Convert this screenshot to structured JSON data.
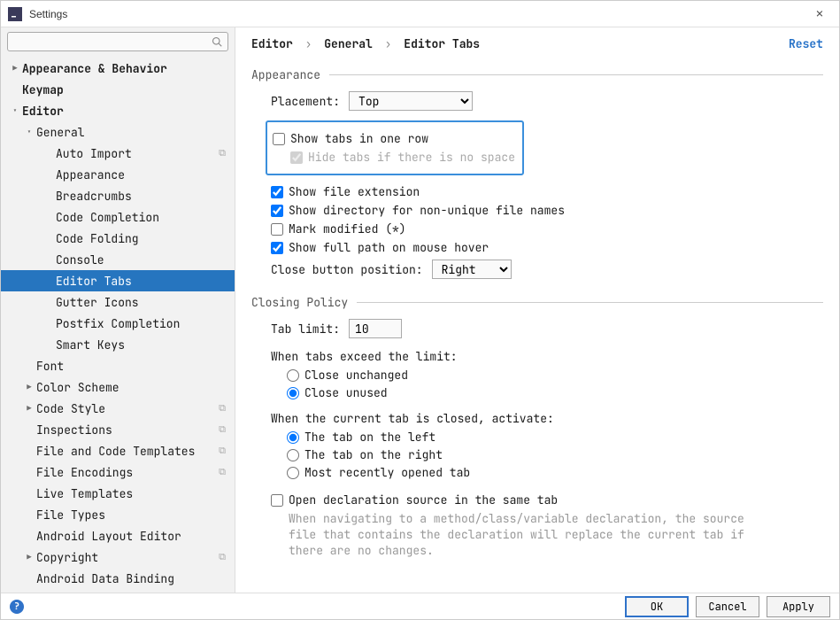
{
  "window": {
    "title": "Settings"
  },
  "search": {
    "placeholder": ""
  },
  "tree": {
    "appearance_behavior": "Appearance & Behavior",
    "keymap": "Keymap",
    "editor": "Editor",
    "general": "General",
    "auto_import": "Auto Import",
    "appearance": "Appearance",
    "breadcrumbs": "Breadcrumbs",
    "code_completion": "Code Completion",
    "code_folding": "Code Folding",
    "console": "Console",
    "editor_tabs": "Editor Tabs",
    "gutter_icons": "Gutter Icons",
    "postfix_completion": "Postfix Completion",
    "smart_keys": "Smart Keys",
    "font": "Font",
    "color_scheme": "Color Scheme",
    "code_style": "Code Style",
    "inspections": "Inspections",
    "file_code_templates": "File and Code Templates",
    "file_encodings": "File Encodings",
    "live_templates": "Live Templates",
    "file_types": "File Types",
    "android_layout_editor": "Android Layout Editor",
    "copyright": "Copyright",
    "android_data_binding": "Android Data Binding"
  },
  "breadcrumb": {
    "p0": "Editor",
    "p1": "General",
    "p2": "Editor Tabs"
  },
  "reset": "Reset",
  "sections": {
    "appearance": "Appearance",
    "closing_policy": "Closing Policy"
  },
  "appearance": {
    "placement_label": "Placement:",
    "placement_value": "Top",
    "show_tabs_one_row": "Show tabs in one row",
    "hide_tabs_no_space": "Hide tabs if there is no space",
    "show_file_ext": "Show file extension",
    "show_dir_nonunique": "Show directory for non-unique file names",
    "mark_modified": "Mark modified (*)",
    "show_full_path_hover": "Show full path on mouse hover",
    "close_button_position_label": "Close button position:",
    "close_button_position_value": "Right"
  },
  "closing": {
    "tab_limit_label": "Tab limit:",
    "tab_limit_value": "10",
    "exceed_label": "When tabs exceed the limit:",
    "exceed_close_unchanged": "Close unchanged",
    "exceed_close_unused": "Close unused",
    "current_closed_label": "When the current tab is closed, activate:",
    "activate_left": "The tab on the left",
    "activate_right": "The tab on the right",
    "activate_recent": "Most recently opened tab",
    "open_decl_same_tab": "Open declaration source in the same tab",
    "open_decl_desc": "When navigating to a method/class/variable declaration, the source file that contains the declaration will replace the current tab if there are no changes."
  },
  "buttons": {
    "ok": "OK",
    "cancel": "Cancel",
    "apply": "Apply"
  }
}
